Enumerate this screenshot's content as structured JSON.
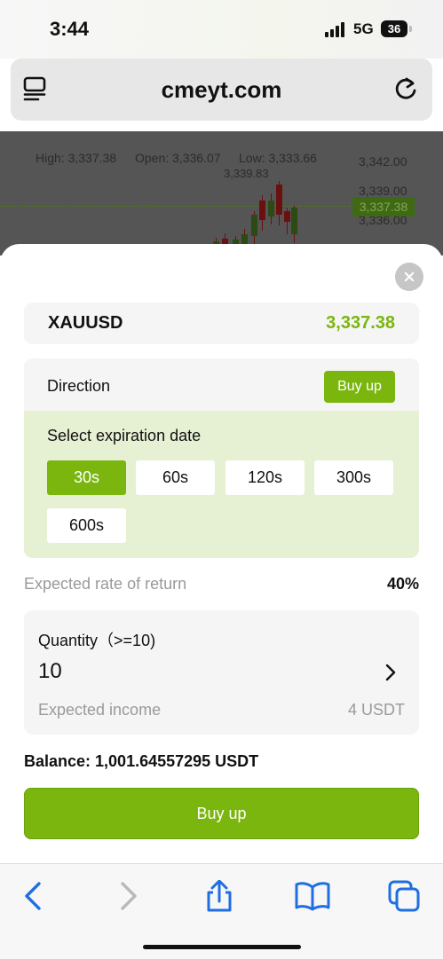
{
  "status_bar": {
    "time": "3:44",
    "network": "5G",
    "battery": "36"
  },
  "browser": {
    "url": "cmeyt.com"
  },
  "chart_backdrop": {
    "high": "High: 3,337.38",
    "open": "Open: 3,336.07",
    "low": "Low: 3,333.66",
    "peak_label": "3,339.83",
    "ticks": [
      "3,342.00",
      "3,339.00",
      "3,336.00"
    ],
    "current_price_tag": "3,337.38"
  },
  "order": {
    "symbol": "XAUUSD",
    "price": "3,337.38",
    "direction_label": "Direction",
    "direction_value": "Buy up",
    "expiration_label": "Select expiration date",
    "expiration_options": [
      "30s",
      "60s",
      "120s",
      "300s",
      "600s"
    ],
    "selected_expiration": "30s",
    "return_label": "Expected rate of return",
    "return_value": "40%",
    "quantity_label": "Quantity（>=10)",
    "quantity_value": "10",
    "income_label": "Expected income",
    "income_value": "4 USDT",
    "balance": "Balance: 1,001.64557295 USDT",
    "submit_label": "Buy up"
  },
  "colors": {
    "accent": "#7ab60e",
    "panel": "#e6f0d3",
    "card": "#f5f5f5"
  },
  "toolbar_icons": [
    "back-icon",
    "forward-icon",
    "share-icon",
    "bookmarks-icon",
    "tabs-icon"
  ]
}
